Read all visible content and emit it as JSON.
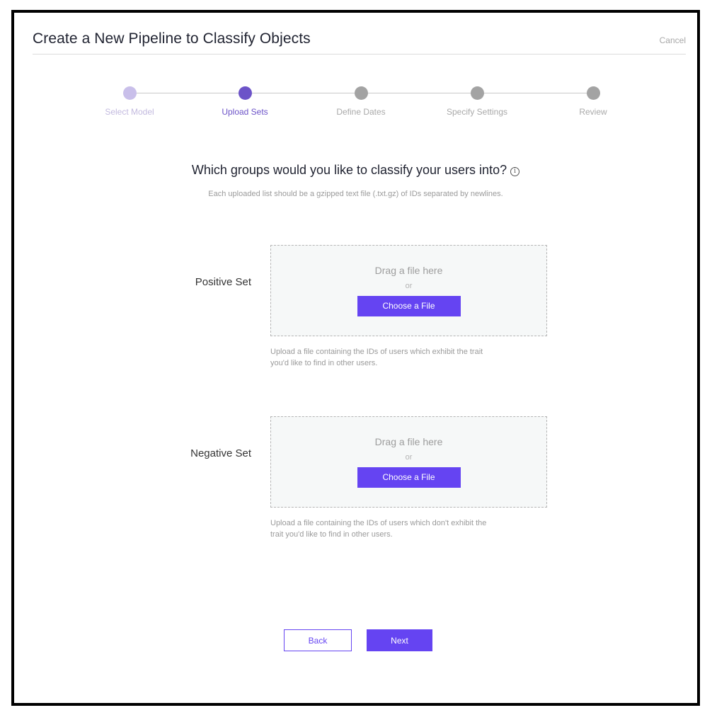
{
  "header": {
    "title": "Create a New Pipeline to Classify Objects",
    "cancel_label": "Cancel"
  },
  "stepper": {
    "steps": [
      {
        "label": "Select Model",
        "state": "done"
      },
      {
        "label": "Upload Sets",
        "state": "active"
      },
      {
        "label": "Define Dates",
        "state": "pending"
      },
      {
        "label": "Specify Settings",
        "state": "pending"
      },
      {
        "label": "Review",
        "state": "pending"
      }
    ]
  },
  "main": {
    "question": "Which groups would you like to classify your users into?",
    "info_icon": "info-icon",
    "hint": "Each uploaded list should be a gzipped text file (.txt.gz) of IDs separated by newlines.",
    "positive": {
      "label": "Positive Set",
      "drag_text": "Drag a file here",
      "or_text": "or",
      "button_label": "Choose a File",
      "help_line1": "Upload a file containing the IDs of users which exhibit the trait",
      "help_line2": "you'd like to find in other users."
    },
    "negative": {
      "label": "Negative Set",
      "drag_text": "Drag a file here",
      "or_text": "or",
      "button_label": "Choose a File",
      "help_line1": "Upload a file containing the IDs of users which don't exhibit the",
      "help_line2": "trait you'd like to find in other users."
    }
  },
  "footer": {
    "back_label": "Back",
    "next_label": "Next"
  },
  "colors": {
    "accent": "#6544f2",
    "step_active": "#6c53c8",
    "step_done": "#c9bfea",
    "step_pending": "#a3a3a3"
  }
}
